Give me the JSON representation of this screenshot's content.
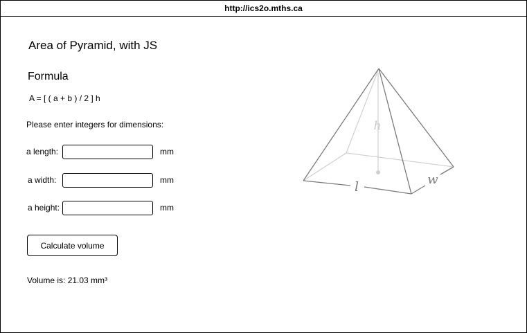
{
  "browser": {
    "url": "http://ics2o.mths.ca"
  },
  "page": {
    "title": "Area of Pyramid, with JS",
    "formula_heading": "Formula",
    "formula": "A = [ ( a + b ) / 2 ] h",
    "instructions": "Please enter integers for dimensions:"
  },
  "form": {
    "length_label": "a length:",
    "width_label": "a width:",
    "height_label": "a height:",
    "length_value": "",
    "width_value": "",
    "height_value": "",
    "unit": "mm",
    "button_label": "Calculate volume"
  },
  "result": {
    "text": "Volume is: 21.03 mm³"
  },
  "diagram": {
    "h_label": "h",
    "l_label": "l",
    "w_label": "w"
  }
}
